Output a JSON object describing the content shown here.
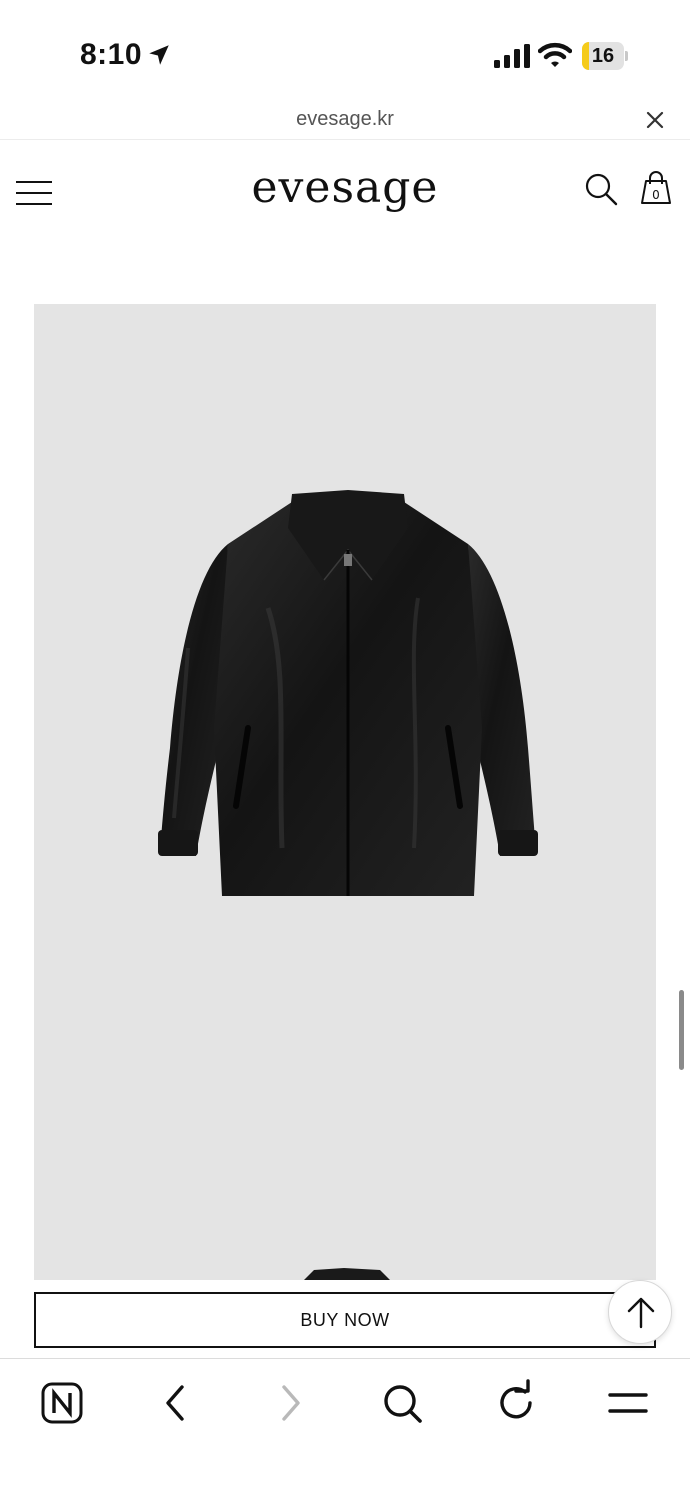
{
  "status_bar": {
    "time": "8:10",
    "battery": "16",
    "battery_level": 0.16,
    "icons": [
      "location-arrow-icon",
      "signal-icon",
      "wifi-icon",
      "battery-icon"
    ]
  },
  "browser": {
    "url": "evesage.kr",
    "toolbar_icons": [
      "naver-icon",
      "back-icon",
      "forward-icon",
      "search-icon",
      "reload-icon",
      "menu-icon"
    ]
  },
  "site": {
    "logo": "evesage",
    "cart_count": "0",
    "header_icons": [
      "menu-icon",
      "search-icon",
      "shopping-bag-icon"
    ]
  },
  "product": {
    "image_subject": "black leather jacket",
    "buy_now_label": "BUY NOW"
  },
  "colors": {
    "image_background": "#e4e4e4",
    "battery_accent": "#f5cb1b",
    "text": "#111111"
  }
}
